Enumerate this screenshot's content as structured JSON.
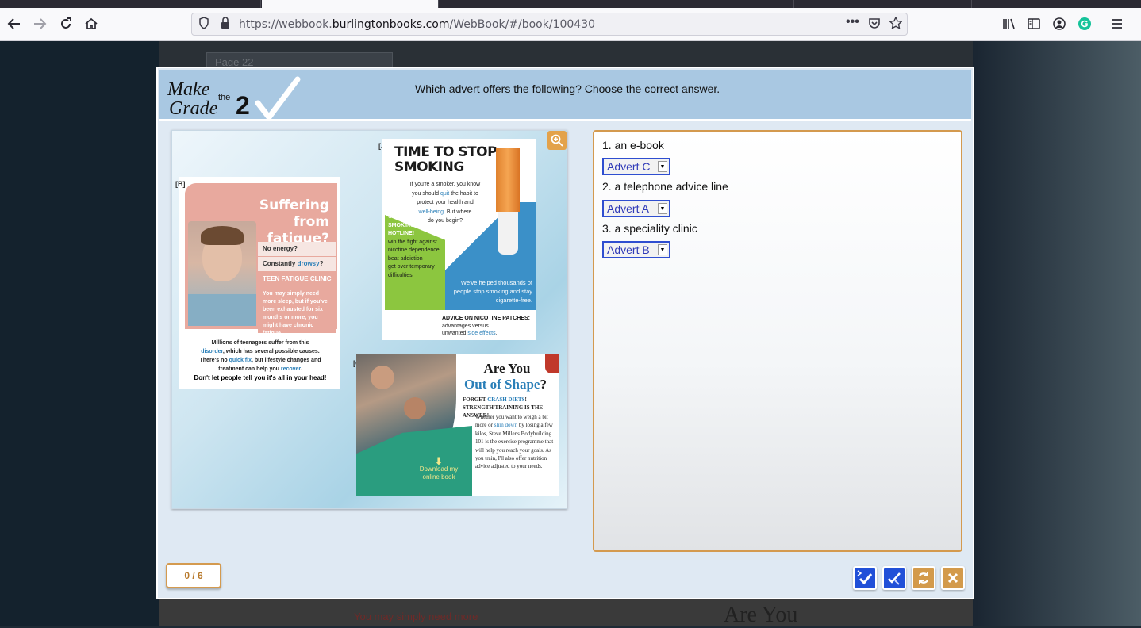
{
  "browser": {
    "url_prefix": "https://webbook.",
    "url_host": "burlingtonbooks.com",
    "url_path": "/WebBook/#/book/100430",
    "icons": [
      "back-icon",
      "forward-icon",
      "reload-icon",
      "home-icon",
      "shield-icon",
      "lock-icon",
      "more-icon",
      "pocket-icon",
      "star-icon",
      "library-icon",
      "sidebar-icon",
      "account-icon",
      "grammarly-icon",
      "menu-icon"
    ]
  },
  "background": {
    "page_label": "Page 22",
    "bottom_text": "You may simply need more",
    "bottom_title": "Are You"
  },
  "modal": {
    "logo": {
      "make": "Make",
      "the": "the",
      "grade": "Grade",
      "number": "2"
    },
    "instruction": "Which advert offers the following? Choose the correct answer.",
    "score": "0 / 6"
  },
  "adverts": {
    "b": {
      "label": "[B]",
      "title_line1": "Suffering from",
      "title_line2": "fatigue?",
      "row1": "No energy?",
      "row2_pre": "Constantly ",
      "row2_word": "drowsy",
      "row2_post": "?",
      "row3": "TEEN FATIGUE CLINIC",
      "body": "You may simply need more sleep, but if you've been exhausted for six months or more, you might have chronic fatigue.",
      "footer_1": "Millions of teenagers suffer from this",
      "footer_2_word": "disorder",
      "footer_2_post": ", which has several possible causes.",
      "footer_3_pre": "There's no ",
      "footer_3_word": "quick fix",
      "footer_3_post": ", but lifestyle changes and",
      "footer_4_pre": "treatment can help you ",
      "footer_4_word": "recover",
      "footer_4_post": ".",
      "footer_5": "Don't let people tell you it's all in your head!"
    },
    "a": {
      "label": "[A]",
      "title_line1": "TIME TO STOP",
      "title_line2": "SMOKING",
      "intro_1": "If you're a smoker, you know",
      "intro_2_pre": "you should ",
      "intro_2_word": "quit",
      "intro_2_post": " the habit to",
      "intro_3": "protect your health and",
      "intro_4_word": "well-being",
      "intro_4_post": ". But where",
      "intro_5": "do you begin?",
      "hotline_1": "CALL",
      "hotline_2": "SMOKING",
      "hotline_3": "HOTLINE!",
      "bullet_1": "win the fight against nicotine dependence",
      "bullet_2": "beat addiction",
      "bullet_3": "get over temporary difficulties",
      "blue_text": "We've helped thousands of people stop smoking and stay cigarette-free.",
      "bottom_title": "ADVICE ON NICOTINE PATCHES:",
      "bottom_1": "advantages versus",
      "bottom_2_pre": "unwanted ",
      "bottom_2_word": "side effects",
      "bottom_2_post": "."
    },
    "c": {
      "label": "[C]",
      "title_line1": "Are You",
      "title_line2": "Out of Shape",
      "title_q": "?",
      "sub_pre": "FORGET ",
      "sub_word": "CRASH DIETS",
      "sub_post": "! STRENGTH TRAINING IS THE ANSWER!",
      "body_pre": "Whether you want to weigh a bit more or ",
      "body_word": "slim down",
      "body_post": " by losing a few kilos, Steve Miller's Bodybuilding 101 is the exercise programme that will help you reach your goals. As you train, I'll also offer nutrition advice adjusted to your needs.",
      "download": "Download my online book"
    }
  },
  "questions": [
    {
      "text": "1. an e-book",
      "answer": "Advert C"
    },
    {
      "text": "2. a telephone advice line",
      "answer": "Advert A"
    },
    {
      "text": "3. a speciality clinic",
      "answer": "Advert B"
    }
  ],
  "colors": {
    "header": "#a9c8e2",
    "panel_border": "#d49a4f",
    "select_border": "#2f4ed0",
    "check_button": "#2150d8",
    "reset_button": "#d39a4b"
  }
}
